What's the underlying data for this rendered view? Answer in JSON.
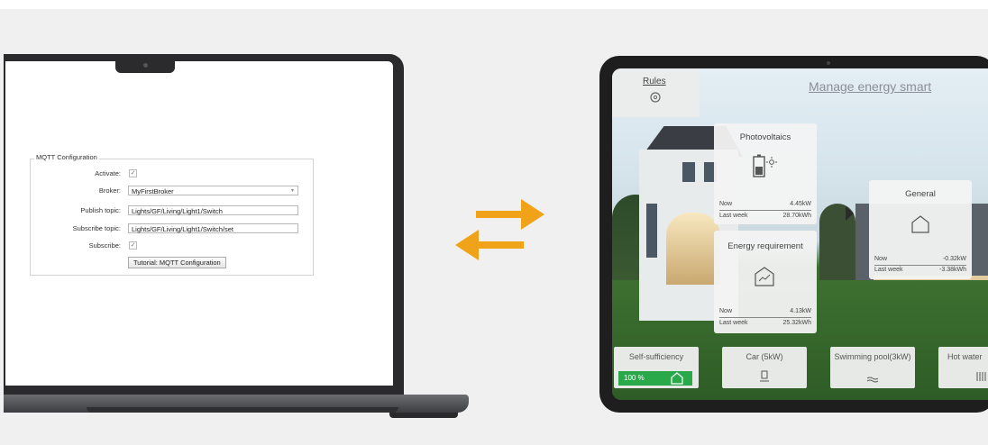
{
  "colors": {
    "arrow": "#f0a318",
    "self_sufficiency_green": "#2aa94a",
    "laptop_bezel": "#2b2b2d",
    "tablet_bezel": "#1e1e1e"
  },
  "laptop": {
    "mqtt": {
      "legend": "MQTT Configuration",
      "activate_label": "Activate:",
      "activate_checked": true,
      "broker_label": "Broker:",
      "broker_value": "MyFirstBroker",
      "publish_label": "Publish topic:",
      "publish_value": "Lights/GF/Living/Light1/Switch",
      "subscribe_topic_label": "Subscribe topic:",
      "subscribe_topic_value": "Lights/GF/Living/Light1/Switch/set",
      "subscribe_label": "Subscribe:",
      "subscribe_checked": true,
      "tutorial_button": "Tutorial: MQTT Configuration"
    }
  },
  "arrows": {
    "right": "arrow-right-icon",
    "left": "arrow-left-icon"
  },
  "tablet": {
    "rules_label": "Rules",
    "title": "Manage energy smart",
    "photovoltaics": {
      "title": "Photovoltaics",
      "now_label": "Now",
      "now_value": "4.45kW",
      "week_label": "Last week",
      "week_value": "28.70kWh"
    },
    "energy_requirement": {
      "title": "Energy requirement",
      "now_label": "Now",
      "now_value": "4.13kW",
      "week_label": "Last week",
      "week_value": "25.32kWh"
    },
    "general": {
      "title": "General",
      "now_label": "Now",
      "now_value": "-0.32kW",
      "week_label": "Last week",
      "week_value": "-3.38kWh"
    },
    "bottom_tiles": {
      "self_sufficiency": {
        "label": "Self-sufficiency",
        "value": "100 %",
        "percent": 100
      },
      "car": {
        "label": "Car (5kW)"
      },
      "pool": {
        "label": "Swimming pool(3kW)"
      },
      "hot_water": {
        "label": "Hot water"
      }
    }
  }
}
